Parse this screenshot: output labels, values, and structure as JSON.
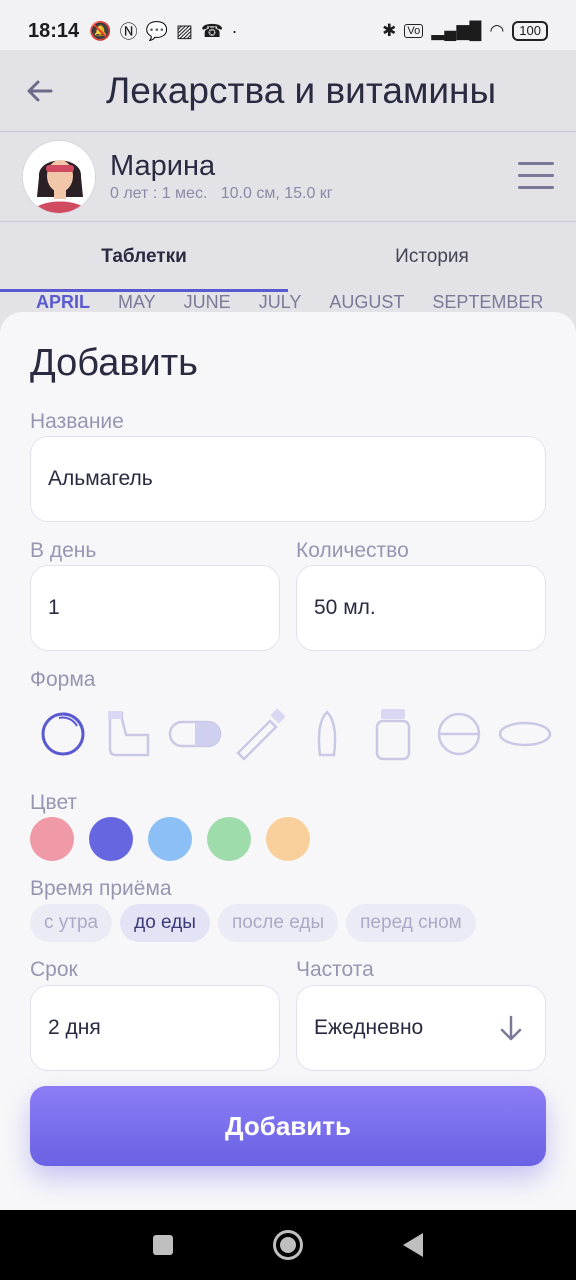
{
  "status_bar": {
    "time": "18:14",
    "left_icons": [
      "mute-icon",
      "nfc-icon",
      "chat-icon",
      "gallery-icon",
      "call-icon",
      "dot-icon"
    ],
    "right_icons": [
      "bluetooth-icon",
      "volte-icon",
      "signal-icon",
      "wifi-icon"
    ],
    "battery": "100"
  },
  "header": {
    "title": "Лекарства и витамины"
  },
  "profile": {
    "name": "Марина",
    "meta": "0 лет : 1 мес.   10.0 см, 15.0 кг"
  },
  "tabs": [
    {
      "label": "Таблетки",
      "active": true
    },
    {
      "label": "История",
      "active": false
    }
  ],
  "months": [
    "APRIL",
    "MAY",
    "JUNE",
    "JULY",
    "AUGUST",
    "SEPTEMBER"
  ],
  "sheet": {
    "title": "Добавить",
    "name_label": "Название",
    "name_value": "Альмагель",
    "per_day_label": "В день",
    "per_day_value": "1",
    "amount_label": "Количество",
    "amount_value": "50 мл.",
    "form_label": "Форма",
    "forms": [
      "capsule-round-icon",
      "inhaler-icon",
      "capsule-icon",
      "tube-icon",
      "suppository-icon",
      "bottle-icon",
      "pill-icon",
      "oval-tablet-icon"
    ],
    "color_label": "Цвет",
    "colors": [
      "#ef9aa6",
      "#6667e0",
      "#8cbff5",
      "#9fdcab",
      "#f9d09b"
    ],
    "time_label": "Время приёма",
    "times": [
      {
        "label": "с утра",
        "selected": false
      },
      {
        "label": "до еды",
        "selected": true
      },
      {
        "label": "после еды",
        "selected": false
      },
      {
        "label": "перед сном",
        "selected": false
      }
    ],
    "duration_label": "Срок",
    "duration_value": "2 дня",
    "frequency_label": "Частота",
    "frequency_value": "Ежедневно",
    "submit_label": "Добавить"
  },
  "accent_color": "#6a62e4"
}
